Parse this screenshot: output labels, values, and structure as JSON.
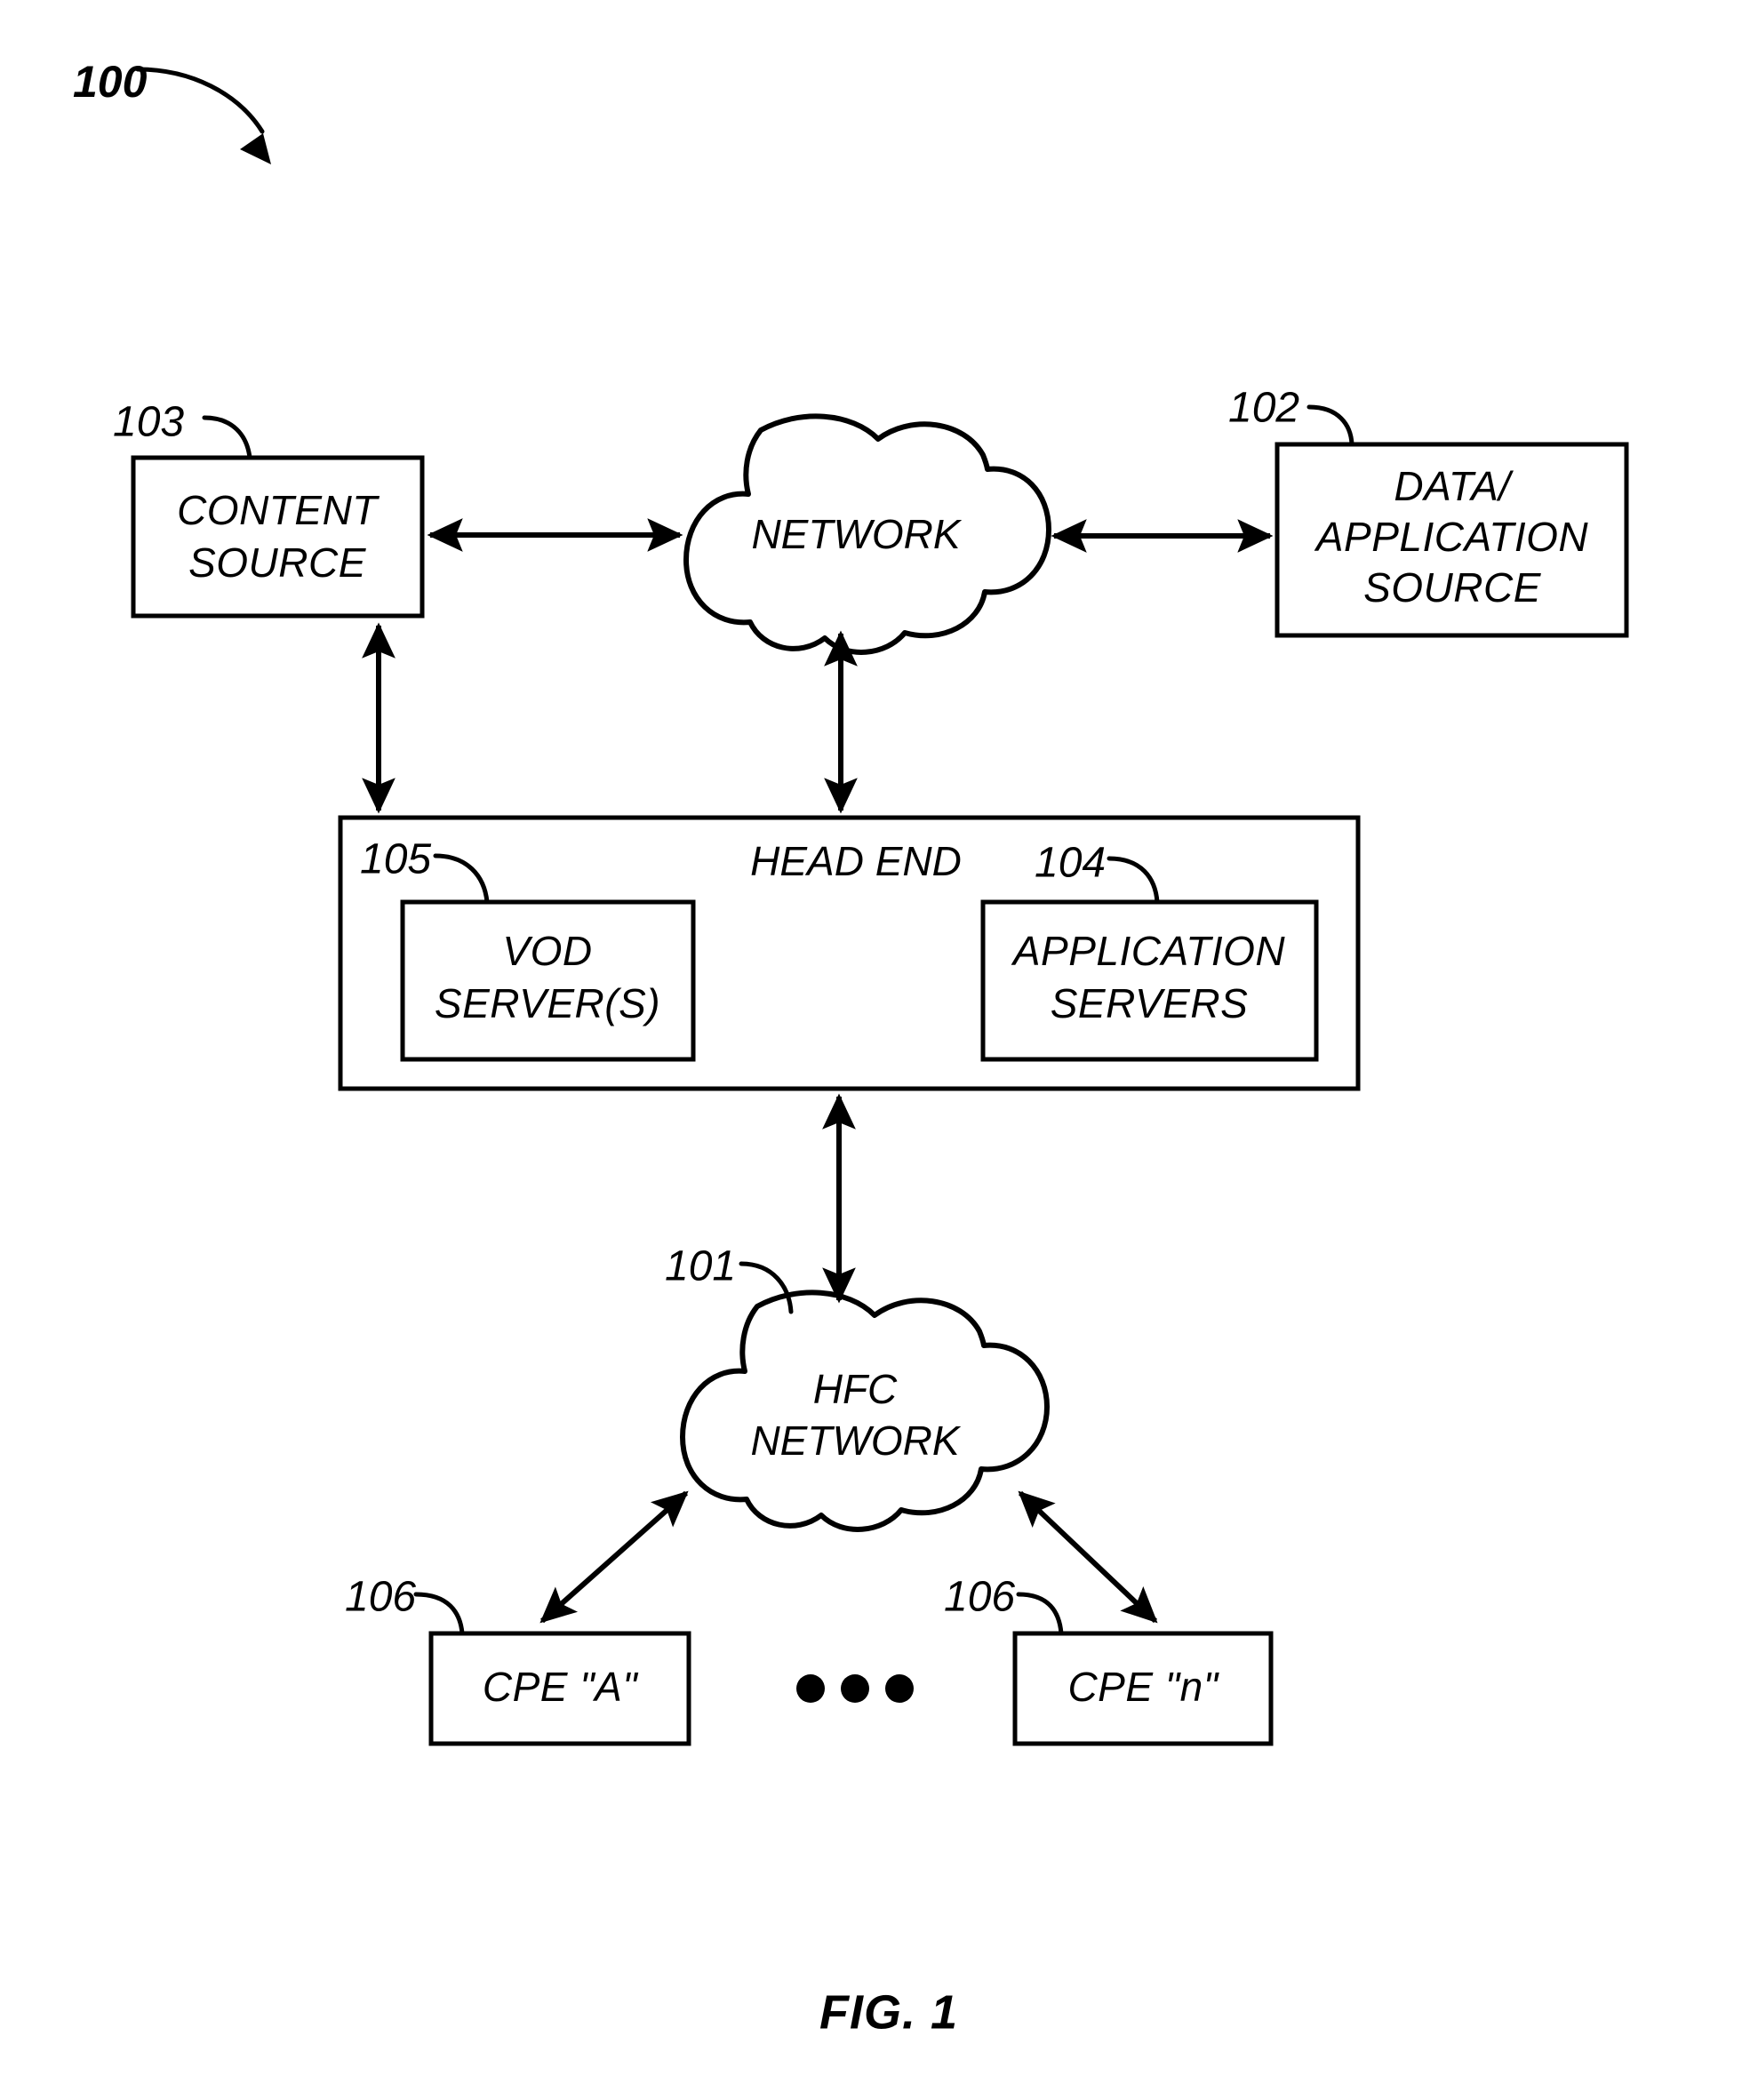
{
  "figure": {
    "caption": "FIG. 1",
    "system_ref": "100"
  },
  "nodes": {
    "content_source": {
      "ref": "103",
      "lines": [
        "CONTENT",
        "SOURCE"
      ]
    },
    "network_cloud": {
      "lines": [
        "NETWORK"
      ]
    },
    "data_application_source": {
      "ref": "102",
      "lines": [
        "DATA/",
        "APPLICATION",
        "SOURCE"
      ]
    },
    "head_end": {
      "title": "HEAD END"
    },
    "vod_server": {
      "ref": "105",
      "lines": [
        "VOD",
        "SERVER(S)"
      ]
    },
    "application_servers": {
      "ref": "104",
      "lines": [
        "APPLICATION",
        "SERVERS"
      ]
    },
    "hfc_network": {
      "ref": "101",
      "lines": [
        "HFC",
        "NETWORK"
      ]
    },
    "cpe_a": {
      "ref": "106",
      "lines": [
        "CPE \"A\""
      ]
    },
    "cpe_n": {
      "ref": "106",
      "lines": [
        "CPE \"n\""
      ]
    }
  },
  "colors": {
    "stroke": "#000000",
    "fill": "#ffffff"
  },
  "chart_data": {
    "type": "diagram",
    "title": "FIG. 1",
    "nodes": [
      {
        "id": "103",
        "label": "CONTENT SOURCE",
        "shape": "rect"
      },
      {
        "id": "network",
        "label": "NETWORK",
        "shape": "cloud"
      },
      {
        "id": "102",
        "label": "DATA/ APPLICATION SOURCE",
        "shape": "rect"
      },
      {
        "id": "head_end",
        "label": "HEAD END",
        "shape": "rect-container"
      },
      {
        "id": "105",
        "label": "VOD SERVER(S)",
        "shape": "rect"
      },
      {
        "id": "104",
        "label": "APPLICATION SERVERS",
        "shape": "rect"
      },
      {
        "id": "101",
        "label": "HFC NETWORK",
        "shape": "cloud"
      },
      {
        "id": "106a",
        "label": "CPE \"A\"",
        "shape": "rect"
      },
      {
        "id": "106n",
        "label": "CPE \"n\"",
        "shape": "rect"
      }
    ],
    "edges": [
      {
        "from": "103",
        "to": "network",
        "style": "bidirectional"
      },
      {
        "from": "network",
        "to": "102",
        "style": "bidirectional"
      },
      {
        "from": "103",
        "to": "head_end",
        "style": "bidirectional"
      },
      {
        "from": "network",
        "to": "head_end",
        "style": "bidirectional"
      },
      {
        "from": "head_end",
        "to": "101",
        "style": "bidirectional"
      },
      {
        "from": "101",
        "to": "106a",
        "style": "bidirectional"
      },
      {
        "from": "101",
        "to": "106n",
        "style": "bidirectional"
      }
    ]
  }
}
